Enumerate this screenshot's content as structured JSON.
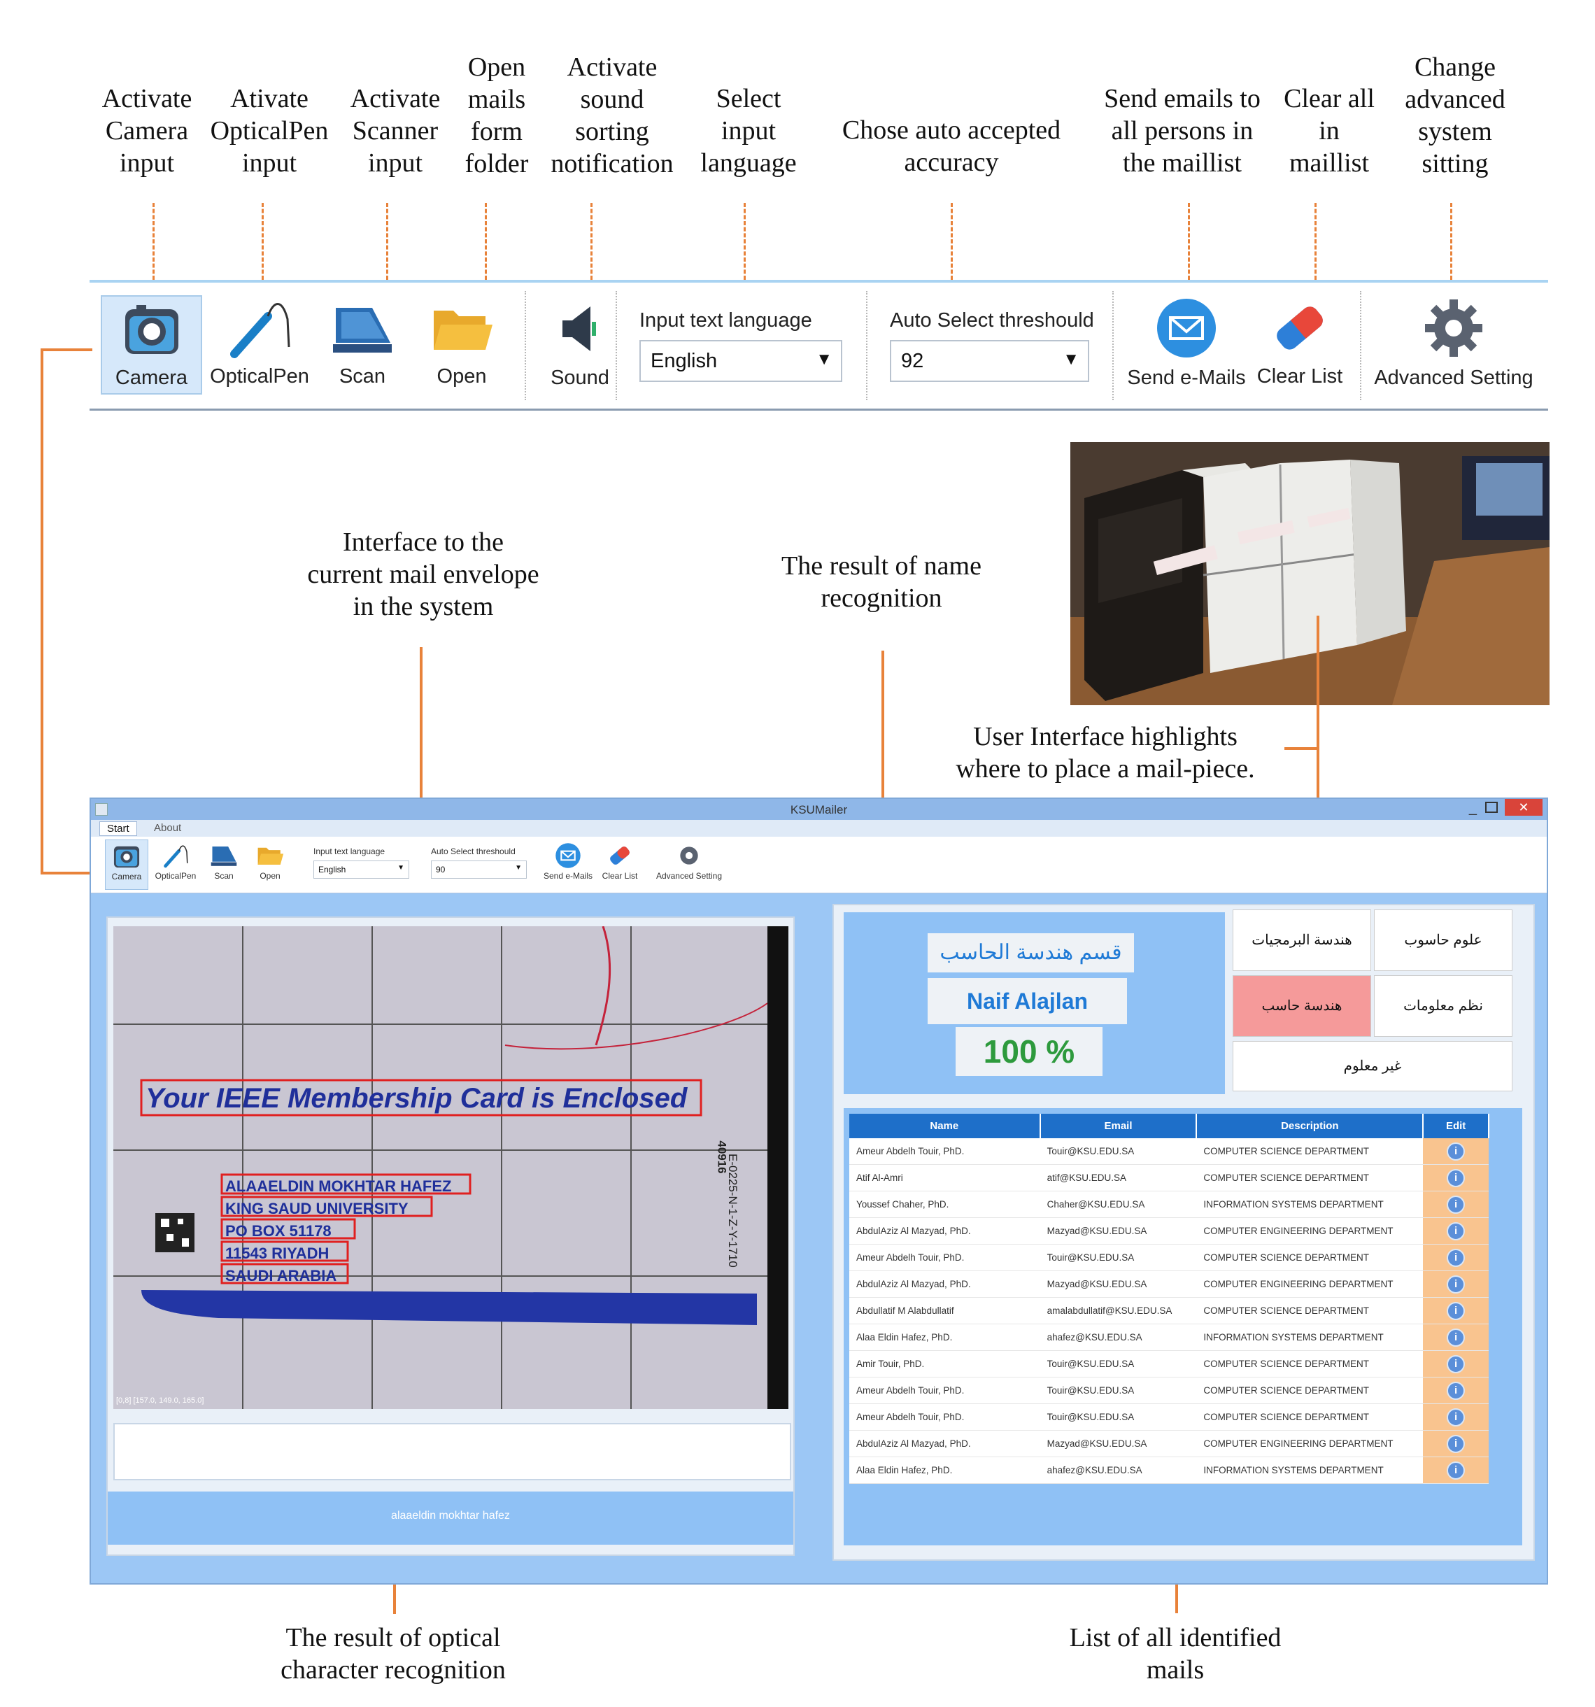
{
  "callouts": {
    "camera": "Activate\nCamera\ninput",
    "opticalpen": "Ativate\nOpticalPen\ninput",
    "scanner": "Activate\nScanner\ninput",
    "open": "Open\nmails\nform\nfolder",
    "sound": "Activate\nsound\nsorting\nnotification",
    "language": "Select\ninput\nlanguage",
    "accuracy": "Chose auto accepted\naccuracy",
    "send": "Send emails to\nall persons in\nthe maillist",
    "clear": "Clear all\nin\nmaillist",
    "advanced": "Change\nadvanced\nsystem\nsitting",
    "envelope": "Interface to the\ncurrent mail envelope\nin the system",
    "name_result": "The result of name\nrecognition",
    "highlight": "User Interface highlights\nwhere to place a mail-piece.",
    "ocr_result": "The result of optical\ncharacter recognition",
    "mail_list": "List of all identified\nmails"
  },
  "toolbar": {
    "camera": "Camera",
    "opticalpen": "OpticalPen",
    "scan": "Scan",
    "open": "Open",
    "sound": "Sound",
    "language_label": "Input text language",
    "language_value": "English",
    "threshold_label": "Auto Select threshould",
    "threshold_value": "92",
    "send": "Send e-Mails",
    "clear": "Clear List",
    "advanced": "Advanced Setting"
  },
  "window": {
    "title": "KSUMailer",
    "tabs": [
      "Start",
      "About"
    ],
    "mini_toolbar": {
      "camera": "Camera",
      "opticalpen": "OpticalPen",
      "scan": "Scan",
      "open": "Open",
      "language_label": "Input text language",
      "language_value": "English",
      "threshold_label": "Auto Select threshould",
      "threshold_value": "90",
      "send": "Send e-Mails",
      "clear": "Clear List",
      "advanced": "Advanced Setting"
    }
  },
  "envelope": {
    "headline": "Your IEEE Membership Card is Enclosed",
    "address_lines": [
      "ALAAELDIN MOKHTAR HAFEZ",
      "KING SAUD UNIVERSITY",
      "PO BOX 51178",
      "11543 RIYADH",
      "SAUDI ARABIA"
    ],
    "side_code": "E-0225-N-1-Z-Y-1710",
    "side_code2": "40916",
    "pixel_readout": "[0,8] [157.0, 149.0, 165.0]",
    "ocr_text": "alaaeldin mokhtar hafez"
  },
  "recognition": {
    "department_ar": "قسم هندسة الحاسب",
    "name": "Naif Alajlan",
    "accuracy": "100 %"
  },
  "bins": {
    "software_eng": "هندسة البرمجيات",
    "computer_science": "علوم حاسوب",
    "computer_eng": "هندسة حاسب",
    "info_systems": "نظم معلومات",
    "unknown": "غير معلوم"
  },
  "mail_table": {
    "headers": [
      "Name",
      "Email",
      "Description",
      "Edit"
    ],
    "rows": [
      [
        "Ameur Abdelh Touir, PhD.",
        "Touir@KSU.EDU.SA",
        "COMPUTER SCIENCE DEPARTMENT"
      ],
      [
        "Atif Al-Amri",
        "atif@KSU.EDU.SA",
        "COMPUTER SCIENCE DEPARTMENT"
      ],
      [
        "Youssef Chaher, PhD.",
        "Chaher@KSU.EDU.SA",
        "INFORMATION SYSTEMS DEPARTMENT"
      ],
      [
        "AbdulAziz Al Mazyad, PhD.",
        "Mazyad@KSU.EDU.SA",
        "COMPUTER ENGINEERING DEPARTMENT"
      ],
      [
        "Ameur Abdelh Touir, PhD.",
        "Touir@KSU.EDU.SA",
        "COMPUTER SCIENCE DEPARTMENT"
      ],
      [
        "AbdulAziz Al Mazyad, PhD.",
        "Mazyad@KSU.EDU.SA",
        "COMPUTER ENGINEERING DEPARTMENT"
      ],
      [
        "Abdullatif M Alabdullatif",
        "amalabdullatif@KSU.EDU.SA",
        "COMPUTER SCIENCE DEPARTMENT"
      ],
      [
        "Alaa Eldin Hafez, PhD.",
        "ahafez@KSU.EDU.SA",
        "INFORMATION SYSTEMS DEPARTMENT"
      ],
      [
        "Amir Touir, PhD.",
        "Touir@KSU.EDU.SA",
        "COMPUTER SCIENCE DEPARTMENT"
      ],
      [
        "Ameur Abdelh Touir, PhD.",
        "Touir@KSU.EDU.SA",
        "COMPUTER SCIENCE DEPARTMENT"
      ],
      [
        "Ameur Abdelh Touir, PhD.",
        "Touir@KSU.EDU.SA",
        "COMPUTER SCIENCE DEPARTMENT"
      ],
      [
        "AbdulAziz Al Mazyad, PhD.",
        "Mazyad@KSU.EDU.SA",
        "COMPUTER ENGINEERING DEPARTMENT"
      ],
      [
        "Alaa Eldin Hafez, PhD.",
        "ahafez@KSU.EDU.SA",
        "INFORMATION SYSTEMS DEPARTMENT"
      ]
    ]
  },
  "colors": {
    "accent_orange": "#e8823a",
    "window_blue": "#9cc7f5",
    "table_header": "#1e6fc9",
    "highlight_bin": "#f59a9a",
    "edit_column": "#f9c48f"
  }
}
